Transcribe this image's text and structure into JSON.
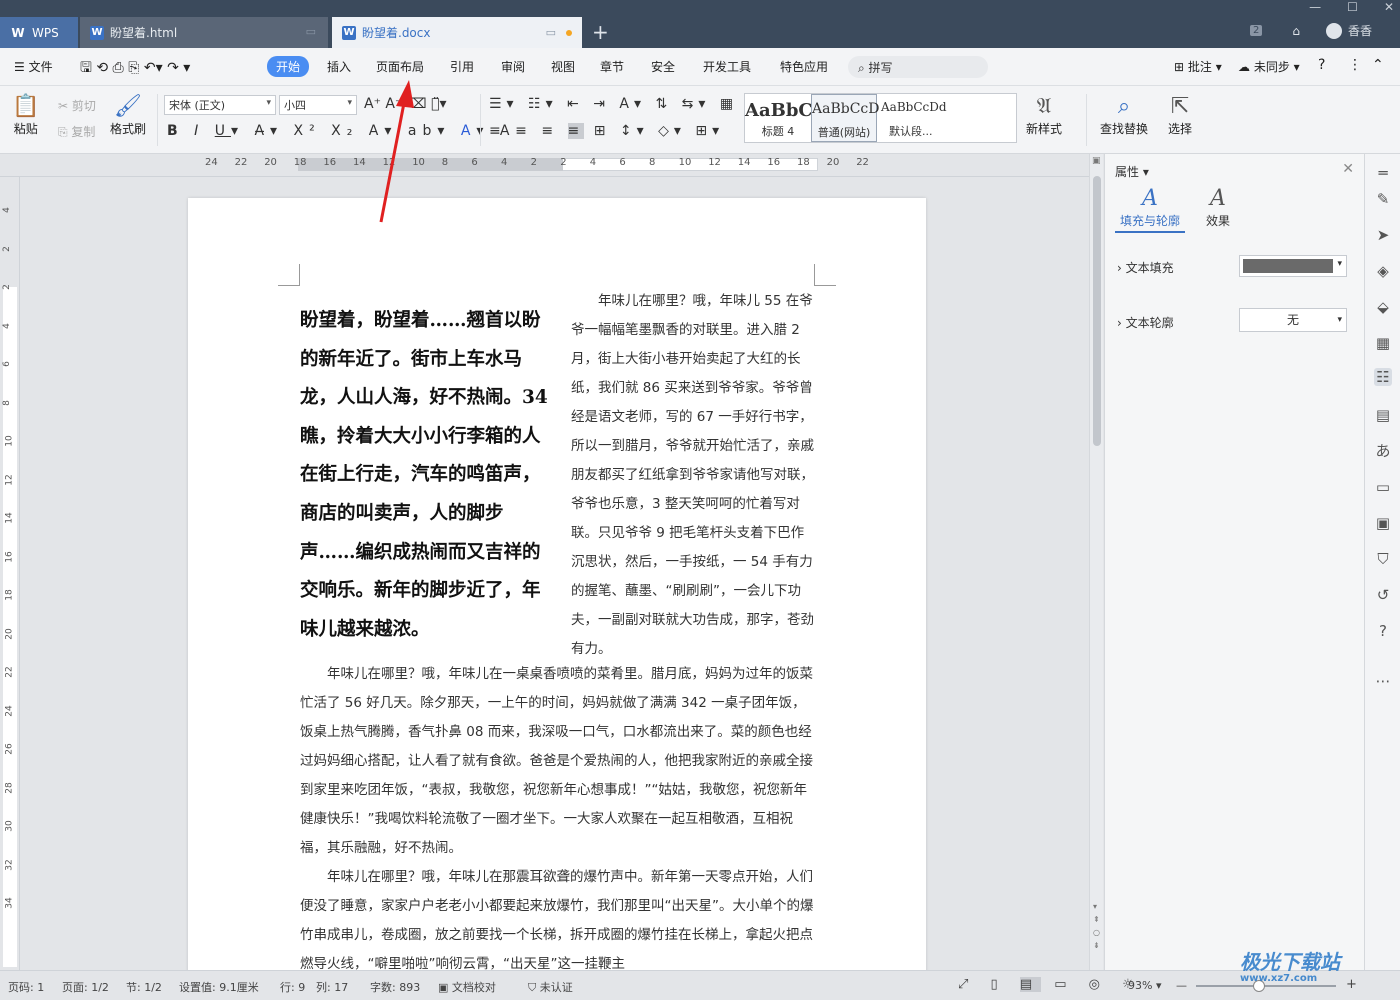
{
  "tabs": {
    "wps": "WPS",
    "html": "盼望着.html",
    "docx": "盼望着.docx"
  },
  "top_right": {
    "badge": "2",
    "user": "香香"
  },
  "menu": {
    "file": "文件",
    "items": [
      "开始",
      "插入",
      "页面布局",
      "引用",
      "审阅",
      "视图",
      "章节",
      "安全",
      "开发工具",
      "特色应用"
    ],
    "search": "拼写",
    "right": [
      "批注",
      "未同步"
    ]
  },
  "ribbon": {
    "paste": "粘贴",
    "cut": "剪切",
    "copy": "复制",
    "format_painter": "格式刷",
    "font": "宋体 (正文)",
    "size": "小四",
    "styles": [
      {
        "sample": "AaBbC",
        "label": "标题 4"
      },
      {
        "sample": "AaBbCcD",
        "label": "普通(网站)"
      },
      {
        "sample": "AaBbCcDd",
        "label": "默认段..."
      }
    ],
    "new_style": "新样式",
    "find_replace": "查找替换",
    "select": "选择"
  },
  "ruler": {
    "h": [
      "24",
      "22",
      "20",
      "18",
      "16",
      "14",
      "12",
      "10",
      "8",
      "6",
      "4",
      "2",
      "2",
      "4",
      "6",
      "8",
      "10",
      "12",
      "14",
      "16",
      "18",
      "20",
      "22"
    ],
    "v": [
      "4",
      "2",
      "2",
      "4",
      "6",
      "8",
      "10",
      "12",
      "14",
      "16",
      "18",
      "20",
      "22",
      "24",
      "26",
      "28",
      "30",
      "32",
      "34"
    ]
  },
  "document": {
    "title_block": "盼望着，盼望着……翘首以盼的新年近了。街市上车水马龙，人山人海，好不热闹。34 瞧，拎着大大小小行李箱的人在街上行走，汽车的鸣笛声，商店的叫卖声，人的脚步声……编织成热闹而又吉祥的交响乐。新年的脚步近了，年味儿越来越浓。",
    "column_para": "年味儿在哪里？哦，年味儿 55 在爷爷一幅幅笔墨飘香的对联里。进入腊 2 月，街上大街小巷开始卖起了大红的长纸，我们就 86 买来送到爷爷家。爷爷曾经是语文老师，写的 67 一手好行书字，所以一到腊月，爷爷就开始忙活了，亲戚朋友都买了红纸拿到爷爷家请他写对联，爷爷也乐意，3 整天笑呵呵的忙着写对联。只见爷爷 9 把毛笔杆头支着下巴作沉思状，然后，一手按纸，一 54 手有力的握笔、蘸墨、“刷刷刷”，一会儿下功夫，一副副对联就大功告成，那字，苍劲有力。",
    "para2": "年味儿在哪里？哦，年味儿在一桌桌香喷喷的菜肴里。腊月底，妈妈为过年的饭菜忙活了 56 好几天。除夕那天，一上午的时间，妈妈就做了满满 342 一桌子团年饭，饭桌上热气腾腾，香气扑鼻 08 而来，我深吸一口气，口水都流出来了。菜的颜色也经过妈妈细心搭配，让人看了就有食欲。爸爸是个爱热闹的人，他把我家附近的亲戚全接到家里来吃团年饭，“表叔，我敬您，祝您新年心想事成！”“姑姑，我敬您，祝您新年健康快乐！”我喝饮料轮流敬了一圈才坐下。一大家人欢聚在一起互相敬酒，互相祝福，其乐融融，好不热闹。",
    "para3": "年味儿在哪里？哦，年味儿在那震耳欲聋的爆竹声中。新年第一天零点开始，人们便没了睡意，家家户户老老小小都要起来放爆竹，我们那里叫“出天星”。大小单个的爆竹串成串儿，卷成圈，放之前要找一个长梯，拆开成圈的爆竹挂在长梯上，拿起火把点燃导火线，“噼里啪啦”响彻云霄，“出天星”这一挂鞭主"
  },
  "panel": {
    "title": "属性",
    "tab_fill": "填充与轮廓",
    "tab_effect": "效果",
    "text_fill": "文本填充",
    "text_outline": "文本轮廓",
    "outline_value": "无",
    "fill_color": "#6a6a6a"
  },
  "status": {
    "page_code": "页码: 1",
    "page": "页面: 1/2",
    "section": "节: 1/2",
    "setting": "设置值: 9.1厘米",
    "row": "行: 9",
    "col": "列: 17",
    "words": "字数: 893",
    "proof": "文档校对",
    "auth": "未认证",
    "zoom": "93%"
  },
  "watermark": {
    "main": "极光下载站",
    "sub": "www.xz7.com"
  },
  "colors": {
    "accent": "#4a8df2",
    "arrow": "#e02020",
    "tabbar": "#3b4a5c"
  }
}
